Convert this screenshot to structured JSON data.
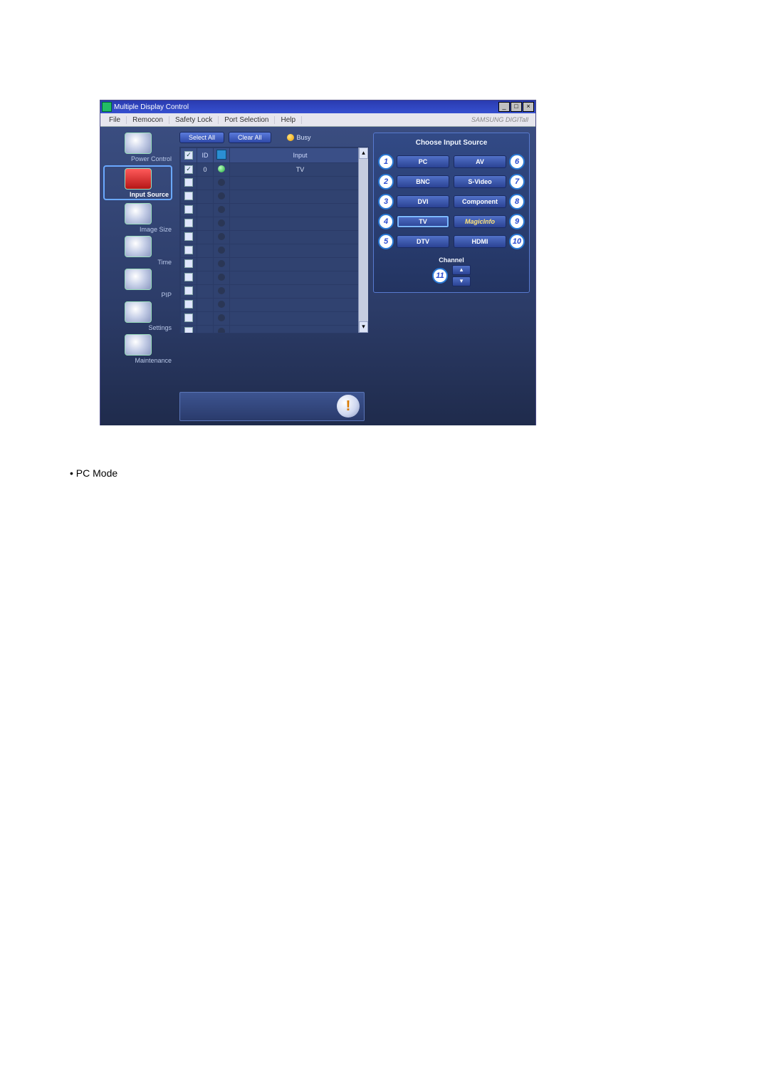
{
  "window": {
    "title": "Multiple Display Control",
    "menu": [
      "File",
      "Remocon",
      "Safety Lock",
      "Port Selection",
      "Help"
    ],
    "brand": "SAMSUNG DIGITall"
  },
  "sidebar": {
    "items": [
      {
        "label": "Power Control"
      },
      {
        "label": "Input Source"
      },
      {
        "label": "Image Size"
      },
      {
        "label": "Time"
      },
      {
        "label": "PIP"
      },
      {
        "label": "Settings"
      },
      {
        "label": "Maintenance"
      }
    ],
    "selected_index": 1
  },
  "toolbar": {
    "select_all": "Select All",
    "clear_all": "Clear All",
    "busy_label": "Busy"
  },
  "grid": {
    "headers": {
      "id": "ID",
      "input": "Input"
    },
    "rows": [
      {
        "checked": true,
        "id": "0",
        "status": "on",
        "input": "TV"
      },
      {
        "checked": false,
        "id": "",
        "status": "off",
        "input": ""
      },
      {
        "checked": false,
        "id": "",
        "status": "off",
        "input": ""
      },
      {
        "checked": false,
        "id": "",
        "status": "off",
        "input": ""
      },
      {
        "checked": false,
        "id": "",
        "status": "off",
        "input": ""
      },
      {
        "checked": false,
        "id": "",
        "status": "off",
        "input": ""
      },
      {
        "checked": false,
        "id": "",
        "status": "off",
        "input": ""
      },
      {
        "checked": false,
        "id": "",
        "status": "off",
        "input": ""
      },
      {
        "checked": false,
        "id": "",
        "status": "off",
        "input": ""
      },
      {
        "checked": false,
        "id": "",
        "status": "off",
        "input": ""
      },
      {
        "checked": false,
        "id": "",
        "status": "off",
        "input": ""
      },
      {
        "checked": false,
        "id": "",
        "status": "off",
        "input": ""
      },
      {
        "checked": false,
        "id": "",
        "status": "off",
        "input": ""
      }
    ]
  },
  "panel": {
    "title": "Choose Input Source",
    "left": [
      {
        "n": "1",
        "label": "PC"
      },
      {
        "n": "2",
        "label": "BNC"
      },
      {
        "n": "3",
        "label": "DVI"
      },
      {
        "n": "4",
        "label": "TV"
      },
      {
        "n": "5",
        "label": "DTV"
      }
    ],
    "right": [
      {
        "n": "6",
        "label": "AV"
      },
      {
        "n": "7",
        "label": "S-Video"
      },
      {
        "n": "8",
        "label": "Component"
      },
      {
        "n": "9",
        "label": "MagicInfo"
      },
      {
        "n": "10",
        "label": "HDMI"
      }
    ],
    "selected_label": "TV",
    "channel": {
      "label": "Channel",
      "n": "11"
    }
  },
  "document": {
    "bullet": "•  PC Mode"
  }
}
